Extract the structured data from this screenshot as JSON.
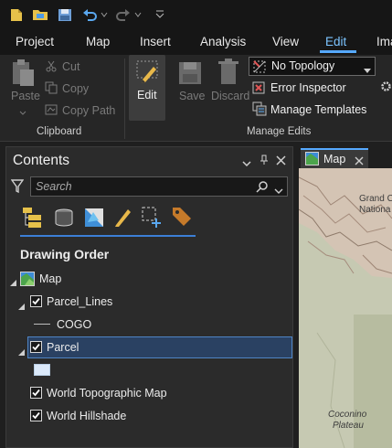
{
  "quick_access": {
    "icons": [
      "new-project-icon",
      "open-project-icon",
      "save-project-icon",
      "undo-icon",
      "redo-icon",
      "customize-quick-access-icon"
    ]
  },
  "ribbon_tabs": [
    {
      "label": "Project"
    },
    {
      "label": "Map"
    },
    {
      "label": "Insert"
    },
    {
      "label": "Analysis"
    },
    {
      "label": "View"
    },
    {
      "label": "Edit",
      "active": true
    },
    {
      "label": "Ima"
    }
  ],
  "clipboard": {
    "paste_label": "Paste",
    "cut_label": "Cut",
    "copy_label": "Copy",
    "copy_path_label": "Copy Path",
    "group_label": "Clipboard"
  },
  "manage_edits": {
    "edit_label": "Edit",
    "save_label": "Save",
    "discard_label": "Discard",
    "topology_value": "No Topology",
    "error_inspector_label": "Error Inspector",
    "manage_templates_label": "Manage Templates",
    "group_label": "Manage Edits"
  },
  "contents": {
    "title": "Contents",
    "search_placeholder": "Search",
    "drawing_order_title": "Drawing Order",
    "map_name": "Map",
    "layers": {
      "parcel_lines": "Parcel_Lines",
      "cogo": "COGO",
      "parcel": "Parcel",
      "world_topo": "World Topographic Map",
      "world_hillshade": "World Hillshade"
    }
  },
  "map_view": {
    "tab_label": "Map",
    "labels": {
      "grand_c": "Grand C",
      "nationa": "Nationa",
      "coconino": "Coconino",
      "plateau": "Plateau"
    }
  },
  "colors": {
    "accent": "#56a9ff",
    "active_tab": "#7cc4ff",
    "selection_bg": "#2a4162",
    "map_land": "#c8cbb5",
    "canyon_red": "#c9a89a"
  }
}
